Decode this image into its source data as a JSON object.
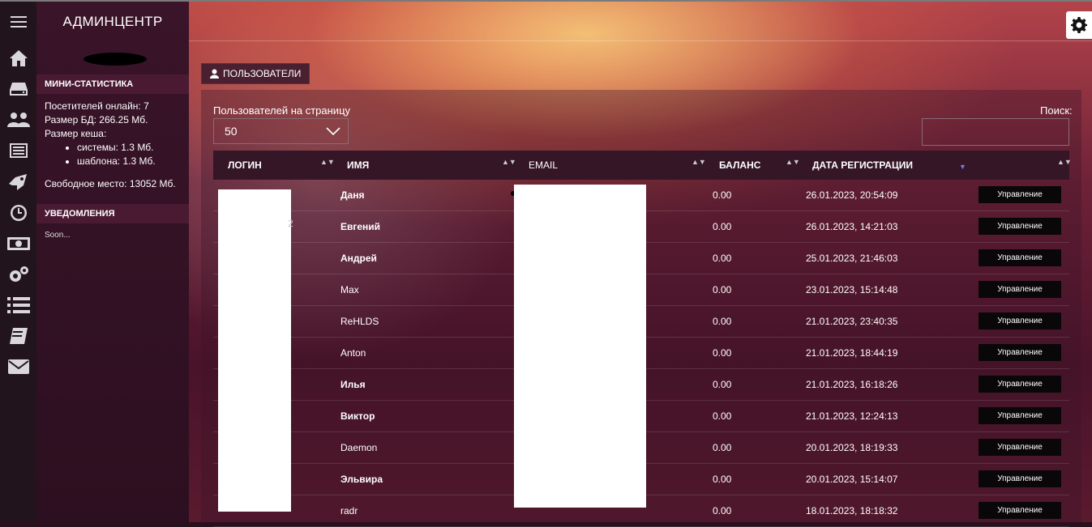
{
  "app": {
    "title": "АДМИНЦЕНТР"
  },
  "rail_icons": [
    "menu-icon",
    "home-icon",
    "drive-icon",
    "users-icon",
    "news-icon",
    "rocket-icon",
    "clock-icon",
    "money-icon",
    "settings-icon",
    "list-icon",
    "book-icon",
    "mail-icon"
  ],
  "stats": {
    "heading": "МИНИ-СТАТИСТИКА",
    "online_label": "Посетителей онлайн:",
    "online_value": "7",
    "db_label": "Размер БД:",
    "db_value": "266.25 Мб.",
    "cache_label": "Размер кеша:",
    "cache_system_label": "системы:",
    "cache_system_value": "1.3 Мб.",
    "cache_template_label": "шаблона:",
    "cache_template_value": "1.3 Мб.",
    "free_label": "Свободное место:",
    "free_value": "13052 Мб."
  },
  "notifications": {
    "heading": "УВЕДОМЛЕНИЯ",
    "text": "Soon..."
  },
  "tab": {
    "label": "ПОЛЬЗОВАТЕЛИ"
  },
  "controls": {
    "per_page_label": "Пользователей на страницу",
    "per_page_value": "50",
    "search_label": "Поиск:"
  },
  "table": {
    "columns": [
      "ЛОГИН",
      "ИМЯ",
      "EMAIL",
      "БАЛАНС",
      "ДАТА РЕГИСТРАЦИИ"
    ],
    "sort_glyph": "▲▼",
    "sort_desc_glyph": "▼",
    "manage_label": "Управление",
    "stray_char": "2",
    "rows": [
      {
        "name": "Даня",
        "balance": "0.00",
        "date": "26.01.2023, 20:54:09",
        "bold": true
      },
      {
        "name": "Евгений",
        "balance": "0.00",
        "date": "26.01.2023, 14:21:03",
        "bold": true
      },
      {
        "name": "Андрей",
        "balance": "0.00",
        "date": "25.01.2023, 21:46:03",
        "bold": true
      },
      {
        "name": "Max",
        "balance": "0.00",
        "date": "23.01.2023, 15:14:48",
        "bold": false
      },
      {
        "name": "ReHLDS",
        "balance": "0.00",
        "date": "21.01.2023, 23:40:35",
        "bold": false
      },
      {
        "name": "Anton",
        "balance": "0.00",
        "date": "21.01.2023, 18:44:19",
        "bold": false
      },
      {
        "name": "Илья",
        "balance": "0.00",
        "date": "21.01.2023, 16:18:26",
        "bold": true
      },
      {
        "name": "Виктор",
        "balance": "0.00",
        "date": "21.01.2023, 12:24:13",
        "bold": true
      },
      {
        "name": "Daemon",
        "balance": "0.00",
        "date": "20.01.2023, 18:19:33",
        "bold": false
      },
      {
        "name": "Эльвира",
        "balance": "0.00",
        "date": "20.01.2023, 15:14:07",
        "bold": true
      },
      {
        "name": "radr",
        "balance": "0.00",
        "date": "18.01.2023, 18:18:32",
        "bold": false
      }
    ]
  }
}
